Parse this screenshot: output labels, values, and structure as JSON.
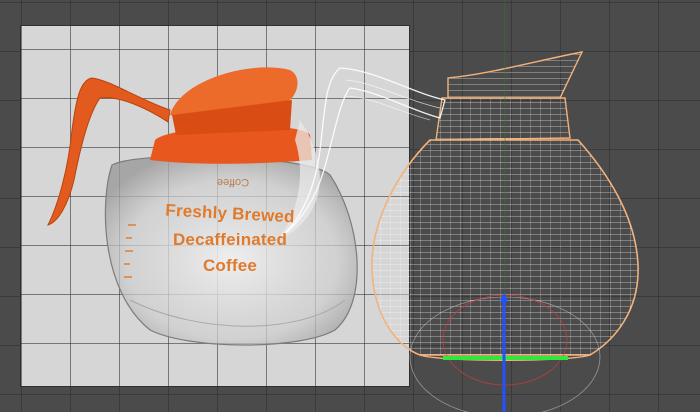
{
  "viewport": {
    "colors": {
      "background": "#4b4b4b",
      "grid": "#3a3a3a",
      "reference_plane": "#d6d6d6",
      "carafe_accent": "#e8581e",
      "wireframe": "#ffffff",
      "axis_x": "#31e83a",
      "axis_y": "#2452ff",
      "axis_z": "#d03a3a",
      "selection_outline": "#f2b27c"
    },
    "reference_image": {
      "label_lines": [
        "Freshly Brewed",
        "Decaffeinated",
        "Coffee"
      ],
      "mirrored_text": "Coffee"
    },
    "icons": [
      "carafe-reference-image",
      "carafe-wireframe-mesh",
      "transform-gizmo"
    ]
  }
}
